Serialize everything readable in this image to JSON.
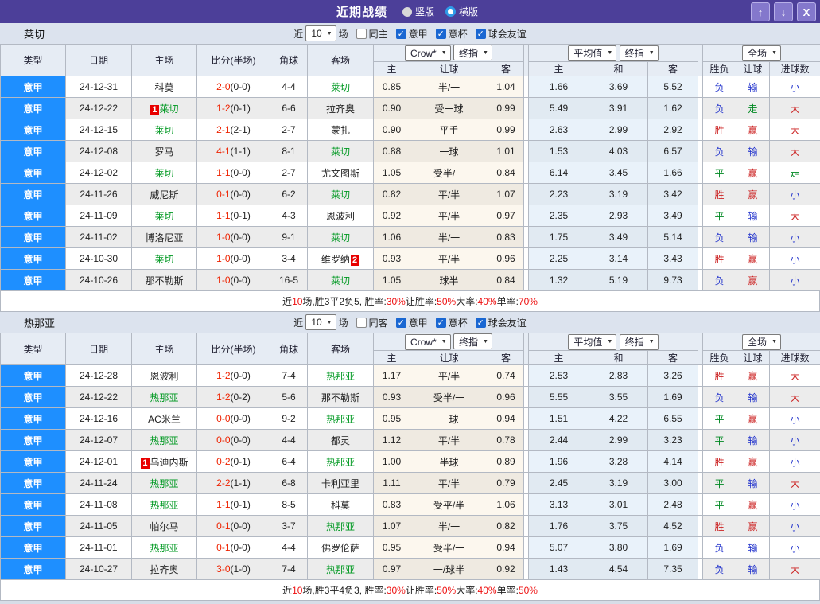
{
  "colors": {
    "titlebar_bg": "#4c3f99",
    "type_column_blue": "#1e8fff",
    "team_green": "#009922",
    "score_red": "#ee2200",
    "result_red": "#cc2222",
    "result_blue": "#2233cc",
    "result_green": "#008822",
    "checkbox_blue": "#1a67d2",
    "badge_red": "#e80000"
  },
  "titlebar": {
    "title": "近期战绩",
    "vertical_label": "竖版",
    "horizontal_label": "横版",
    "icons": {
      "up": "↑",
      "down": "↓",
      "close": "X"
    }
  },
  "controls": {
    "near": "近",
    "count": "10",
    "count_suffix": "场",
    "league1": "意甲",
    "league2": "意杯",
    "league3": "球会友谊"
  },
  "header": {
    "type": "类型",
    "date": "日期",
    "home": "主场",
    "score": "比分(半场)",
    "corner": "角球",
    "away": "客场",
    "select_crow": "Crow*",
    "select_final": "终指",
    "select_avg": "平均值",
    "select_full": "全场",
    "sub": [
      "主",
      "让球",
      "客",
      "主",
      "和",
      "客",
      "胜负",
      "让球",
      "进球数"
    ]
  },
  "result_colors": {
    "胜": "red",
    "平": "green",
    "负": "blue",
    "赢": "red",
    "走": "green",
    "输": "blue",
    "大": "red",
    "小": "blue"
  },
  "sections": [
    {
      "team": "莱切",
      "same_label": "同主",
      "rows": [
        {
          "lg": "意甲",
          "dt": "24-12-31",
          "hm": "科莫",
          "hg": false,
          "hb": "",
          "ft": "2-0",
          "ht": "(0-0)",
          "cn": "4-4",
          "aw": "莱切",
          "ag": true,
          "ab": "",
          "o1": "0.85",
          "hc": "半/一",
          "o2": "1.04",
          "a1": "1.66",
          "a2": "3.69",
          "a3": "5.52",
          "r1": "负",
          "r2": "输",
          "r3": "小"
        },
        {
          "lg": "意甲",
          "dt": "24-12-22",
          "hm": "莱切",
          "hg": true,
          "hb": "1",
          "ft": "1-2",
          "ht": "(0-1)",
          "cn": "6-6",
          "aw": "拉齐奥",
          "ag": false,
          "ab": "",
          "o1": "0.90",
          "hc": "受一球",
          "o2": "0.99",
          "a1": "5.49",
          "a2": "3.91",
          "a3": "1.62",
          "r1": "负",
          "r2": "走",
          "r3": "大"
        },
        {
          "lg": "意甲",
          "dt": "24-12-15",
          "hm": "莱切",
          "hg": true,
          "hb": "",
          "ft": "2-1",
          "ht": "(2-1)",
          "cn": "2-7",
          "aw": "蒙扎",
          "ag": false,
          "ab": "",
          "o1": "0.90",
          "hc": "平手",
          "o2": "0.99",
          "a1": "2.63",
          "a2": "2.99",
          "a3": "2.92",
          "r1": "胜",
          "r2": "赢",
          "r3": "大"
        },
        {
          "lg": "意甲",
          "dt": "24-12-08",
          "hm": "罗马",
          "hg": false,
          "hb": "",
          "ft": "4-1",
          "ht": "(1-1)",
          "cn": "8-1",
          "aw": "莱切",
          "ag": true,
          "ab": "",
          "o1": "0.88",
          "hc": "一球",
          "o2": "1.01",
          "a1": "1.53",
          "a2": "4.03",
          "a3": "6.57",
          "r1": "负",
          "r2": "输",
          "r3": "大"
        },
        {
          "lg": "意甲",
          "dt": "24-12-02",
          "hm": "莱切",
          "hg": true,
          "hb": "",
          "ft": "1-1",
          "ht": "(0-0)",
          "cn": "2-7",
          "aw": "尤文图斯",
          "ag": false,
          "ab": "",
          "o1": "1.05",
          "hc": "受半/一",
          "o2": "0.84",
          "a1": "6.14",
          "a2": "3.45",
          "a3": "1.66",
          "r1": "平",
          "r2": "赢",
          "r3": "走"
        },
        {
          "lg": "意甲",
          "dt": "24-11-26",
          "hm": "威尼斯",
          "hg": false,
          "hb": "",
          "ft": "0-1",
          "ht": "(0-0)",
          "cn": "6-2",
          "aw": "莱切",
          "ag": true,
          "ab": "",
          "o1": "0.82",
          "hc": "平/半",
          "o2": "1.07",
          "a1": "2.23",
          "a2": "3.19",
          "a3": "3.42",
          "r1": "胜",
          "r2": "赢",
          "r3": "小"
        },
        {
          "lg": "意甲",
          "dt": "24-11-09",
          "hm": "莱切",
          "hg": true,
          "hb": "",
          "ft": "1-1",
          "ht": "(0-1)",
          "cn": "4-3",
          "aw": "恩波利",
          "ag": false,
          "ab": "",
          "o1": "0.92",
          "hc": "平/半",
          "o2": "0.97",
          "a1": "2.35",
          "a2": "2.93",
          "a3": "3.49",
          "r1": "平",
          "r2": "输",
          "r3": "大"
        },
        {
          "lg": "意甲",
          "dt": "24-11-02",
          "hm": "博洛尼亚",
          "hg": false,
          "hb": "",
          "ft": "1-0",
          "ht": "(0-0)",
          "cn": "9-1",
          "aw": "莱切",
          "ag": true,
          "ab": "",
          "o1": "1.06",
          "hc": "半/一",
          "o2": "0.83",
          "a1": "1.75",
          "a2": "3.49",
          "a3": "5.14",
          "r1": "负",
          "r2": "输",
          "r3": "小"
        },
        {
          "lg": "意甲",
          "dt": "24-10-30",
          "hm": "莱切",
          "hg": true,
          "hb": "",
          "ft": "1-0",
          "ht": "(0-0)",
          "cn": "3-4",
          "aw": "维罗纳",
          "ag": false,
          "ab": "2",
          "o1": "0.93",
          "hc": "平/半",
          "o2": "0.96",
          "a1": "2.25",
          "a2": "3.14",
          "a3": "3.43",
          "r1": "胜",
          "r2": "赢",
          "r3": "小"
        },
        {
          "lg": "意甲",
          "dt": "24-10-26",
          "hm": "那不勒斯",
          "hg": false,
          "hb": "",
          "ft": "1-0",
          "ht": "(0-0)",
          "cn": "16-5",
          "aw": "莱切",
          "ag": true,
          "ab": "",
          "o1": "1.05",
          "hc": "球半",
          "o2": "0.84",
          "a1": "1.32",
          "a2": "5.19",
          "a3": "9.73",
          "r1": "负",
          "r2": "赢",
          "r3": "小"
        }
      ],
      "summary": [
        [
          "近",
          "k"
        ],
        [
          "10",
          "r"
        ],
        [
          "场,胜3平2负5, 胜率:",
          "k"
        ],
        [
          "30%",
          "r"
        ],
        [
          " 让胜率:",
          "k"
        ],
        [
          "50%",
          "r"
        ],
        [
          " 大率:",
          "k"
        ],
        [
          "40%",
          "r"
        ],
        [
          " 单率:",
          "k"
        ],
        [
          "70%",
          "r"
        ]
      ]
    },
    {
      "team": "热那亚",
      "same_label": "同客",
      "rows": [
        {
          "lg": "意甲",
          "dt": "24-12-28",
          "hm": "恩波利",
          "hg": false,
          "hb": "",
          "ft": "1-2",
          "ht": "(0-0)",
          "cn": "7-4",
          "aw": "热那亚",
          "ag": true,
          "ab": "",
          "o1": "1.17",
          "hc": "平/半",
          "o2": "0.74",
          "a1": "2.53",
          "a2": "2.83",
          "a3": "3.26",
          "r1": "胜",
          "r2": "赢",
          "r3": "大"
        },
        {
          "lg": "意甲",
          "dt": "24-12-22",
          "hm": "热那亚",
          "hg": true,
          "hb": "",
          "ft": "1-2",
          "ht": "(0-2)",
          "cn": "5-6",
          "aw": "那不勒斯",
          "ag": false,
          "ab": "",
          "o1": "0.93",
          "hc": "受半/一",
          "o2": "0.96",
          "a1": "5.55",
          "a2": "3.55",
          "a3": "1.69",
          "r1": "负",
          "r2": "输",
          "r3": "大"
        },
        {
          "lg": "意甲",
          "dt": "24-12-16",
          "hm": "AC米兰",
          "hg": false,
          "hb": "",
          "ft": "0-0",
          "ht": "(0-0)",
          "cn": "9-2",
          "aw": "热那亚",
          "ag": true,
          "ab": "",
          "o1": "0.95",
          "hc": "一球",
          "o2": "0.94",
          "a1": "1.51",
          "a2": "4.22",
          "a3": "6.55",
          "r1": "平",
          "r2": "赢",
          "r3": "小"
        },
        {
          "lg": "意甲",
          "dt": "24-12-07",
          "hm": "热那亚",
          "hg": true,
          "hb": "",
          "ft": "0-0",
          "ht": "(0-0)",
          "cn": "4-4",
          "aw": "都灵",
          "ag": false,
          "ab": "",
          "o1": "1.12",
          "hc": "平/半",
          "o2": "0.78",
          "a1": "2.44",
          "a2": "2.99",
          "a3": "3.23",
          "r1": "平",
          "r2": "输",
          "r3": "小"
        },
        {
          "lg": "意甲",
          "dt": "24-12-01",
          "hm": "乌迪内斯",
          "hg": false,
          "hb": "1",
          "ft": "0-2",
          "ht": "(0-1)",
          "cn": "6-4",
          "aw": "热那亚",
          "ag": true,
          "ab": "",
          "o1": "1.00",
          "hc": "半球",
          "o2": "0.89",
          "a1": "1.96",
          "a2": "3.28",
          "a3": "4.14",
          "r1": "胜",
          "r2": "赢",
          "r3": "小"
        },
        {
          "lg": "意甲",
          "dt": "24-11-24",
          "hm": "热那亚",
          "hg": true,
          "hb": "",
          "ft": "2-2",
          "ht": "(1-1)",
          "cn": "6-8",
          "aw": "卡利亚里",
          "ag": false,
          "ab": "",
          "o1": "1.11",
          "hc": "平/半",
          "o2": "0.79",
          "a1": "2.45",
          "a2": "3.19",
          "a3": "3.00",
          "r1": "平",
          "r2": "输",
          "r3": "大"
        },
        {
          "lg": "意甲",
          "dt": "24-11-08",
          "hm": "热那亚",
          "hg": true,
          "hb": "",
          "ft": "1-1",
          "ht": "(0-1)",
          "cn": "8-5",
          "aw": "科莫",
          "ag": false,
          "ab": "",
          "o1": "0.83",
          "hc": "受平/半",
          "o2": "1.06",
          "a1": "3.13",
          "a2": "3.01",
          "a3": "2.48",
          "r1": "平",
          "r2": "赢",
          "r3": "小"
        },
        {
          "lg": "意甲",
          "dt": "24-11-05",
          "hm": "帕尔马",
          "hg": false,
          "hb": "",
          "ft": "0-1",
          "ht": "(0-0)",
          "cn": "3-7",
          "aw": "热那亚",
          "ag": true,
          "ab": "",
          "o1": "1.07",
          "hc": "半/一",
          "o2": "0.82",
          "a1": "1.76",
          "a2": "3.75",
          "a3": "4.52",
          "r1": "胜",
          "r2": "赢",
          "r3": "小"
        },
        {
          "lg": "意甲",
          "dt": "24-11-01",
          "hm": "热那亚",
          "hg": true,
          "hb": "",
          "ft": "0-1",
          "ht": "(0-0)",
          "cn": "4-4",
          "aw": "佛罗伦萨",
          "ag": false,
          "ab": "",
          "o1": "0.95",
          "hc": "受半/一",
          "o2": "0.94",
          "a1": "5.07",
          "a2": "3.80",
          "a3": "1.69",
          "r1": "负",
          "r2": "输",
          "r3": "小"
        },
        {
          "lg": "意甲",
          "dt": "24-10-27",
          "hm": "拉齐奥",
          "hg": false,
          "hb": "",
          "ft": "3-0",
          "ht": "(1-0)",
          "cn": "7-4",
          "aw": "热那亚",
          "ag": true,
          "ab": "",
          "o1": "0.97",
          "hc": "一/球半",
          "o2": "0.92",
          "a1": "1.43",
          "a2": "4.54",
          "a3": "7.35",
          "r1": "负",
          "r2": "输",
          "r3": "大"
        }
      ],
      "summary": [
        [
          "近",
          "k"
        ],
        [
          "10",
          "r"
        ],
        [
          "场,胜3平4负3, 胜率:",
          "k"
        ],
        [
          "30%",
          "r"
        ],
        [
          " 让胜率:",
          "k"
        ],
        [
          "50%",
          "r"
        ],
        [
          " 大率:",
          "k"
        ],
        [
          "40%",
          "r"
        ],
        [
          " 单率:",
          "k"
        ],
        [
          "50%",
          "r"
        ]
      ]
    }
  ]
}
